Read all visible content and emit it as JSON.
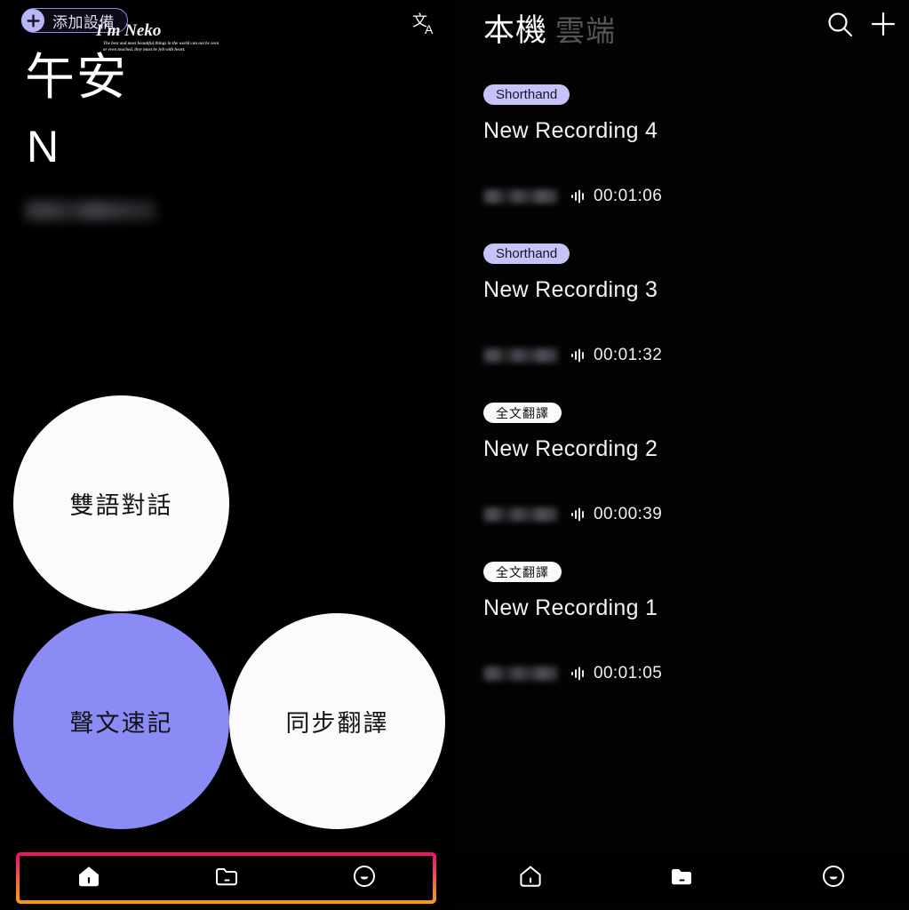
{
  "left": {
    "add_device": {
      "label": "添加設備",
      "icon": "plus-icon",
      "accent": "#8e8bf0"
    },
    "translate_icon": {
      "name": "translate-icon",
      "glyph_top": "文",
      "glyph_bottom": "A"
    },
    "greeting": "午安",
    "greeting_sub": "N",
    "redacted_name": "",
    "circles": [
      {
        "label": "雙語對話",
        "style": "white",
        "color": "#fbfbfb"
      },
      {
        "label": "聲文速記",
        "style": "purple",
        "color": "#8b8bf5"
      },
      {
        "label": "同步翻譯",
        "style": "white",
        "color": "#fbfbfb"
      }
    ],
    "nav": {
      "highlighted": true,
      "border_gradient_from": "#ed1164",
      "border_gradient_to": "#f59b12",
      "items": [
        {
          "icon": "home-icon",
          "state": "filled"
        },
        {
          "icon": "folder-icon",
          "state": "outline"
        },
        {
          "icon": "smiley-icon",
          "state": "outline"
        }
      ]
    }
  },
  "right": {
    "tabs": [
      {
        "label": "本機",
        "active": true
      },
      {
        "label": "雲端",
        "active": false
      }
    ],
    "actions": [
      {
        "icon": "search-icon"
      },
      {
        "icon": "plus-icon"
      }
    ],
    "recordings": [
      {
        "badge": "Shorthand",
        "badge_style": "purple",
        "title": "New Recording 4",
        "date": "",
        "duration": "00:01:06"
      },
      {
        "badge": "Shorthand",
        "badge_style": "purple",
        "title": "New Recording 3",
        "date": "",
        "duration": "00:01:32"
      },
      {
        "badge": "全文翻譯",
        "badge_style": "white",
        "title": "New Recording 2",
        "date": "",
        "duration": "00:00:39"
      },
      {
        "badge": "全文翻譯",
        "badge_style": "white",
        "title": "New Recording 1",
        "date": "",
        "duration": "00:01:05"
      }
    ],
    "nav": {
      "items": [
        {
          "icon": "home-icon",
          "state": "outline"
        },
        {
          "icon": "folder-icon",
          "state": "filled"
        },
        {
          "icon": "smiley-icon",
          "state": "outline"
        }
      ]
    }
  },
  "watermark": {
    "name": "I'm Neko",
    "sub_line1": "The best and most beautiful things in the world can not be seen",
    "sub_line2": "or even touched, they must be felt with heart."
  },
  "colors": {
    "background": "#000000",
    "accent_purple": "#8b8bf5",
    "badge_purple": "#c5c3f7",
    "nav_pink": "#ed1164",
    "nav_orange": "#f59b12"
  }
}
